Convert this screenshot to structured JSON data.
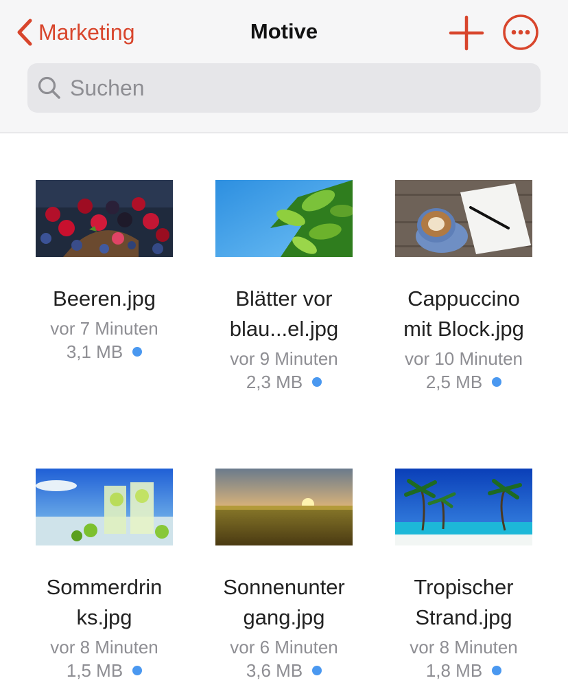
{
  "nav": {
    "back_label": "Marketing",
    "title": "Motive",
    "accent_color": "#d8452c"
  },
  "search": {
    "placeholder": "Suchen",
    "value": ""
  },
  "files": [
    {
      "name_line1": "Beeren.jpg",
      "name_line2": "",
      "modified": "vor 7 Minuten",
      "size": "3,1 MB",
      "thumbnail": "berries-photo"
    },
    {
      "name_line1": "Blätter vor",
      "name_line2": "blau...el.jpg",
      "modified": "vor 9 Minuten",
      "size": "2,3 MB",
      "thumbnail": "leaves-sky-photo"
    },
    {
      "name_line1": "Cappuccino",
      "name_line2": "mit Block.jpg",
      "modified": "vor 10 Minuten",
      "size": "2,5 MB",
      "thumbnail": "cappuccino-notebook-photo"
    },
    {
      "name_line1": "Sommerdrin",
      "name_line2": "ks.jpg",
      "modified": "vor 8 Minuten",
      "size": "1,5 MB",
      "thumbnail": "summer-drinks-photo"
    },
    {
      "name_line1": "Sonnenunter",
      "name_line2": "gang.jpg",
      "modified": "vor 6 Minuten",
      "size": "3,6 MB",
      "thumbnail": "sunset-field-photo"
    },
    {
      "name_line1": "Tropischer",
      "name_line2": "Strand.jpg",
      "modified": "vor 8 Minuten",
      "size": "1,8 MB",
      "thumbnail": "tropical-beach-photo"
    }
  ],
  "sync_dot_color": "#4a98f0"
}
